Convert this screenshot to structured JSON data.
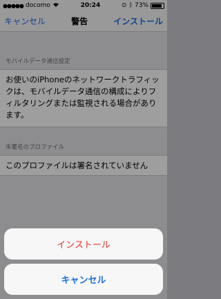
{
  "status_bar": {
    "carrier": "docomo",
    "time": "20:24",
    "battery": "73%"
  },
  "navbar": {
    "cancel_label": "キャンセル",
    "title": "警告",
    "install_label": "インストール"
  },
  "section_network": {
    "header": "モバイルデータ通信設定",
    "body": "お使いのiPhoneのネットワークトラフィックは、モバイルデータ通信の構成によりフィルタリングまたは監視される場合があります。"
  },
  "section_unsigned": {
    "header": "未署名のプロファイル",
    "body": "このプロファイルは署名されていません"
  },
  "action_sheet": {
    "install_label": "インストール",
    "cancel_label": "キャンセル"
  },
  "colors": {
    "accent": "#1a6ee0",
    "destructive": "#e3332b"
  }
}
